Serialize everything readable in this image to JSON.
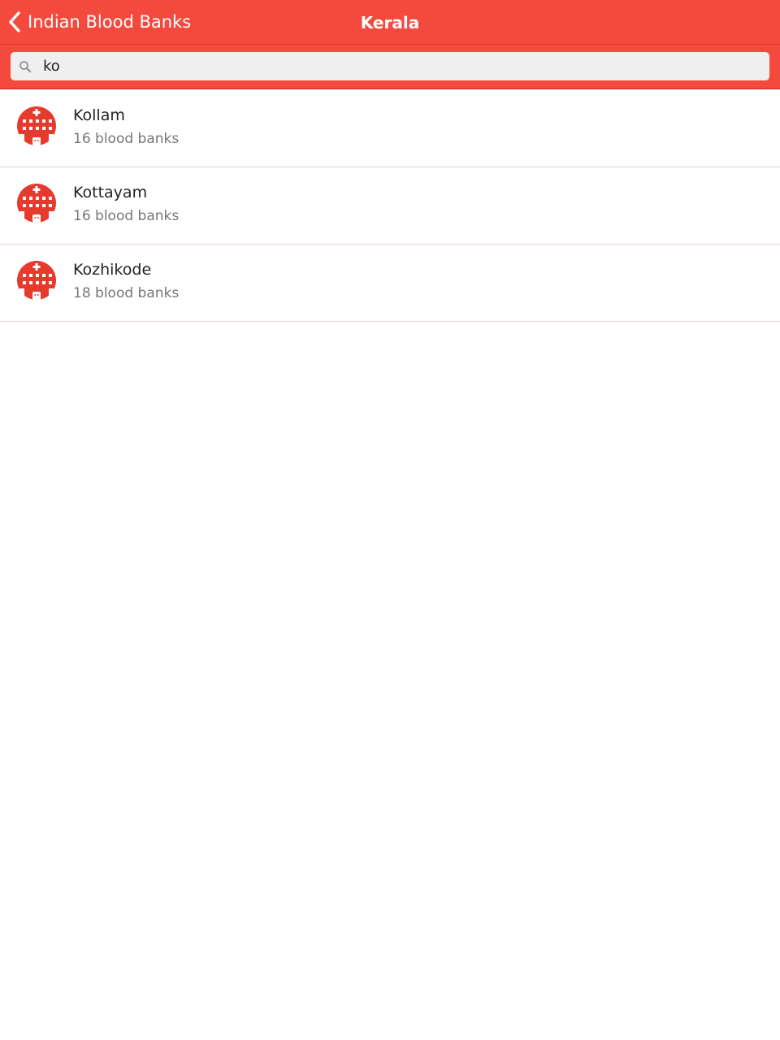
{
  "navbar": {
    "back_label": "Indian Blood Banks",
    "title": "Kerala",
    "back_icon": "chevron-left-icon",
    "color": "#f44a3e"
  },
  "search": {
    "value": "ko",
    "icon": "search-icon"
  },
  "districts": [
    {
      "name": "Kollam",
      "count_label": "16 blood banks",
      "icon": "hospital-icon"
    },
    {
      "name": "Kottayam",
      "count_label": "16 blood banks",
      "icon": "hospital-icon"
    },
    {
      "name": "Kozhikode",
      "count_label": "18 blood banks",
      "icon": "hospital-icon"
    }
  ],
  "colors": {
    "accent": "#f44a3e",
    "icon_red": "#e63a2c",
    "divider": "#f2c9d3"
  }
}
